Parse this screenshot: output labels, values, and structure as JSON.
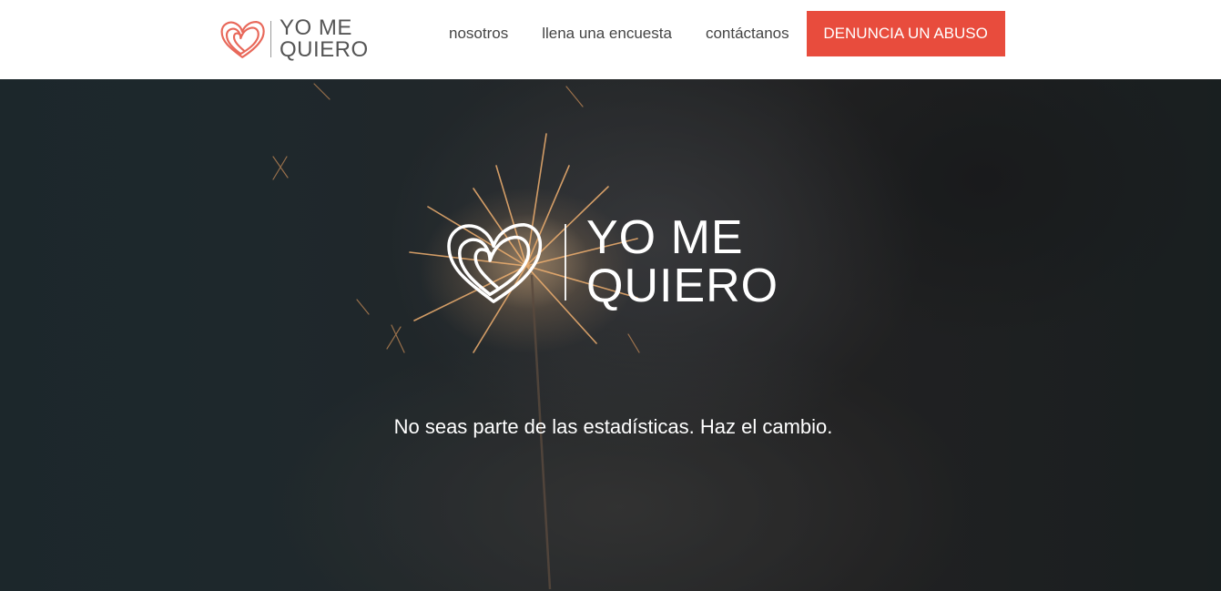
{
  "header": {
    "brand": {
      "line1": "YO ME",
      "line2": "QUIERO",
      "icon": "heart-icon"
    },
    "nav": [
      {
        "label": "nosotros"
      },
      {
        "label": "llena una encuesta"
      },
      {
        "label": "contáctanos"
      }
    ],
    "cta_label": "DENUNCIA UN ABUSO"
  },
  "hero": {
    "logo": {
      "line1": "YO ME",
      "line2": "QUIERO",
      "icon": "heart-icon"
    },
    "tagline": "No seas parte de las estadísticas. Haz el cambio."
  },
  "colors": {
    "accent": "#e84c3d",
    "nav_text": "#444444",
    "brand_text": "#555555"
  }
}
